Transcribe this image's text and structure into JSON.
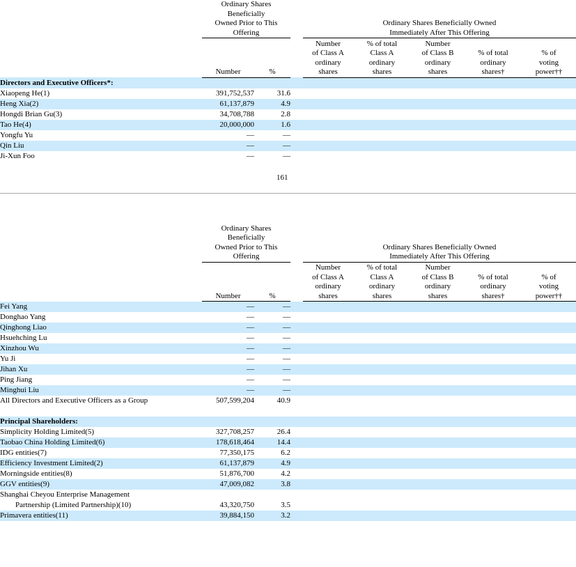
{
  "document": {
    "page_number": "161"
  },
  "headers": {
    "prior_group_lines": [
      "Ordinary Shares",
      "Beneficially",
      "Owned Prior to This",
      "Offering"
    ],
    "after_group_lines": [
      "Ordinary Shares Beneficially Owned",
      "Immediately After This Offering"
    ],
    "columns": {
      "name": "",
      "number": "Number",
      "percent": "%",
      "class_a_number": [
        "Number",
        "of Class A",
        "ordinary",
        "shares"
      ],
      "class_a_percent": [
        "% of total",
        "Class A",
        "ordinary",
        "shares"
      ],
      "class_b_number": [
        "Number",
        "of Class B",
        "ordinary",
        "shares"
      ],
      "total_percent": [
        "% of total",
        "ordinary",
        "shares†"
      ],
      "voting_percent": [
        "% of",
        "voting",
        "power††"
      ]
    }
  },
  "table_one": {
    "rows": [
      {
        "label": "Directors and Executive Officers*:",
        "bold": true,
        "shaded": true,
        "number": "",
        "percent": ""
      },
      {
        "label": "Xiaopeng He(1)",
        "bold": false,
        "shaded": false,
        "number": "391,752,537",
        "percent": "31.6"
      },
      {
        "label": "Heng Xia(2)",
        "bold": false,
        "shaded": true,
        "number": "61,137,879",
        "percent": "4.9"
      },
      {
        "label": "Hongdi Brian Gu(3)",
        "bold": false,
        "shaded": false,
        "number": "34,708,788",
        "percent": "2.8"
      },
      {
        "label": "Tao He(4)",
        "bold": false,
        "shaded": true,
        "number": "20,000,000",
        "percent": "1.6"
      },
      {
        "label": "Yongfu Yu",
        "bold": false,
        "shaded": false,
        "number": "—",
        "percent": "—"
      },
      {
        "label": "Qin Liu",
        "bold": false,
        "shaded": true,
        "number": "—",
        "percent": "—"
      },
      {
        "label": "Ji-Xun Foo",
        "bold": false,
        "shaded": false,
        "number": "—",
        "percent": "—"
      }
    ]
  },
  "table_two": {
    "rows": [
      {
        "label": "Fei Yang",
        "bold": false,
        "shaded": true,
        "number": "—",
        "percent": "—"
      },
      {
        "label": "Donghao Yang",
        "bold": false,
        "shaded": false,
        "number": "—",
        "percent": "—"
      },
      {
        "label": "Qinghong Liao",
        "bold": false,
        "shaded": true,
        "number": "—",
        "percent": "—"
      },
      {
        "label": "Hsuehching Lu",
        "bold": false,
        "shaded": false,
        "number": "—",
        "percent": "—"
      },
      {
        "label": "Xinzhou Wu",
        "bold": false,
        "shaded": true,
        "number": "—",
        "percent": "—"
      },
      {
        "label": "Yu Ji",
        "bold": false,
        "shaded": false,
        "number": "—",
        "percent": "—"
      },
      {
        "label": "Jihan Xu",
        "bold": false,
        "shaded": true,
        "number": "—",
        "percent": "—"
      },
      {
        "label": "Ping Jiang",
        "bold": false,
        "shaded": false,
        "number": "—",
        "percent": "—"
      },
      {
        "label": "Minghui Liu",
        "bold": false,
        "shaded": true,
        "number": "—",
        "percent": "—"
      },
      {
        "label": "All Directors and Executive Officers as a Group",
        "bold": false,
        "shaded": false,
        "number": "507,599,204",
        "percent": "40.9"
      },
      {
        "label": "",
        "bold": false,
        "shaded": false,
        "spacer": true,
        "number": "",
        "percent": ""
      },
      {
        "label": "Principal Shareholders:",
        "bold": true,
        "shaded": true,
        "number": "",
        "percent": ""
      },
      {
        "label": "Simplicity Holding Limited(5)",
        "bold": false,
        "shaded": false,
        "number": "327,708,257",
        "percent": "26.4"
      },
      {
        "label": "Taobao China Holding Limited(6)",
        "bold": false,
        "shaded": true,
        "number": "178,618,464",
        "percent": "14.4"
      },
      {
        "label": "IDG entities(7)",
        "bold": false,
        "shaded": false,
        "number": "77,350,175",
        "percent": "6.2"
      },
      {
        "label": "Efficiency Investment Limited(2)",
        "bold": false,
        "shaded": true,
        "number": "61,137,879",
        "percent": "4.9"
      },
      {
        "label": "Morningside entities(8)",
        "bold": false,
        "shaded": false,
        "number": "51,876,700",
        "percent": "4.2"
      },
      {
        "label": "GGV entities(9)",
        "bold": false,
        "shaded": true,
        "number": "47,009,082",
        "percent": "3.8"
      },
      {
        "label": "Shanghai Cheyou Enterprise Management",
        "bold": false,
        "shaded": false,
        "number": "",
        "percent": ""
      },
      {
        "label": "Partnership (Limited Partnership)(10)",
        "bold": false,
        "shaded": false,
        "indent": true,
        "number": "43,320,750",
        "percent": "3.5"
      },
      {
        "label": "Primavera entities(11)",
        "bold": false,
        "shaded": true,
        "number": "39,884,150",
        "percent": "3.2"
      }
    ]
  },
  "colors": {
    "row_shade": "#cceafc",
    "rule": "#a8a8a8",
    "text": "#000000"
  }
}
